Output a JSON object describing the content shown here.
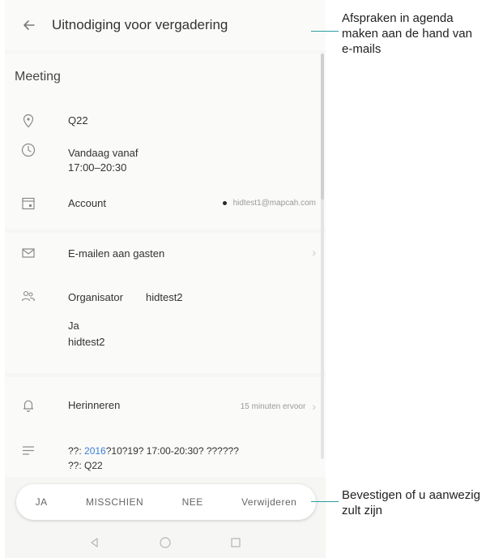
{
  "header": {
    "title": "Uitnodiging voor vergadering"
  },
  "event": {
    "name": "Meeting",
    "location": "Q22",
    "time_line1": "Vandaag vanaf",
    "time_line2": "17:00–20:30",
    "account_label": "Account",
    "account_value": "hidtest1@mapcah.com"
  },
  "guests": {
    "email_label": "E-mailen aan gasten",
    "organizer_label": "Organisator",
    "organizer_name": "hidtest2",
    "attendee_response": "Ja",
    "attendee_name": "hidtest2"
  },
  "details": {
    "reminder_label": "Herinneren",
    "reminder_value": "15 minuten ervoor",
    "description_prefix": "??: ",
    "description_link": "2016",
    "description_rest": "?10?19? 17:00-20:30? ??????",
    "description_line2": "??: Q22"
  },
  "actions": {
    "yes": "JA",
    "maybe": "MISSCHIEN",
    "no": "NEE",
    "delete": "Verwijderen"
  },
  "callouts": {
    "top": "Afspraken in agenda maken aan de hand van e-mails",
    "bottom": "Bevestigen of u aanwezig zult zijn"
  },
  "colors": {
    "accent": "#2aa0a3",
    "link": "#3b7fd6",
    "icon": "#8a8a8a"
  },
  "icons": [
    "back-arrow-icon",
    "location-pin-icon",
    "clock-icon",
    "calendar-account-icon",
    "mail-icon",
    "people-icon",
    "bell-icon",
    "description-lines-icon",
    "nav-back-icon",
    "nav-home-icon",
    "nav-recents-icon"
  ]
}
